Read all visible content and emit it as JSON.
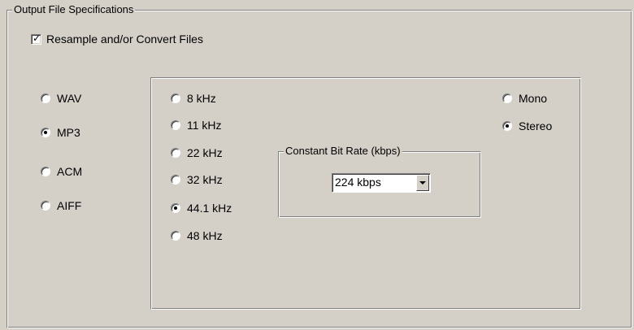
{
  "output_group": {
    "label": "Output File Specifications"
  },
  "resample": {
    "label": "Resample and/or Convert Files",
    "checked": true
  },
  "formats": [
    {
      "label": "WAV",
      "selected": false
    },
    {
      "label": "MP3",
      "selected": true
    },
    {
      "label": "ACM",
      "selected": false
    },
    {
      "label": "AIFF",
      "selected": false
    }
  ],
  "sample_rates": [
    {
      "label": "8 kHz",
      "selected": false
    },
    {
      "label": "11 kHz",
      "selected": false
    },
    {
      "label": "22 kHz",
      "selected": false
    },
    {
      "label": "32 kHz",
      "selected": false
    },
    {
      "label": "44.1 kHz",
      "selected": true
    },
    {
      "label": "48 kHz",
      "selected": false
    }
  ],
  "channels": [
    {
      "label": "Mono",
      "selected": false
    },
    {
      "label": "Stereo",
      "selected": true
    }
  ],
  "bitrate_group": {
    "label": "Constant Bit Rate (kbps)"
  },
  "bitrate_combo": {
    "value": "224 kbps"
  }
}
